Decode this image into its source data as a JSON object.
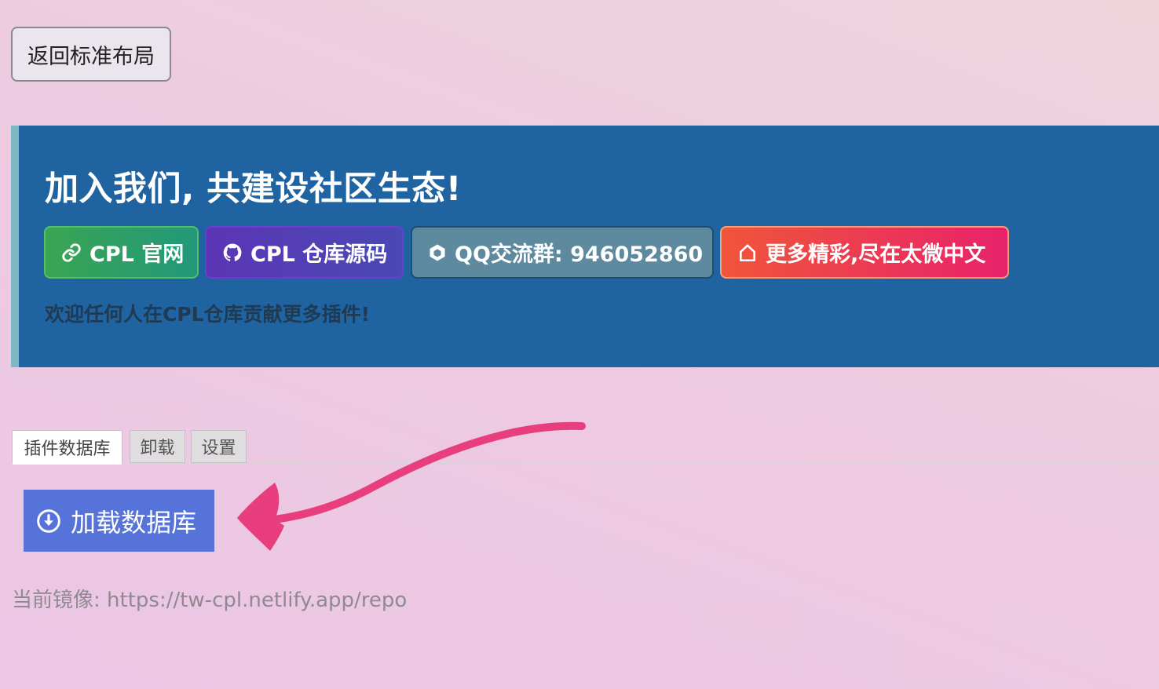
{
  "back_button": {
    "label": "返回标准布局"
  },
  "banner": {
    "title": "加入我们, 共建设社区生态!",
    "links": [
      {
        "icon": "link-icon",
        "label": "CPL 官网"
      },
      {
        "icon": "github-icon",
        "label": "CPL 仓库源码"
      },
      {
        "icon": "cube-icon",
        "label": "QQ交流群: 946052860"
      },
      {
        "icon": "home-icon",
        "label": "更多精彩,尽在太微中文"
      }
    ],
    "note": "欢迎任何人在CPL仓库贡献更多插件!"
  },
  "tabs": [
    {
      "label": "插件数据库",
      "active": true
    },
    {
      "label": "卸载",
      "active": false
    },
    {
      "label": "设置",
      "active": false
    }
  ],
  "load_button": {
    "icon": "download-circle-icon",
    "label": "加载数据库"
  },
  "mirror": {
    "label": "当前镜像:",
    "url": "https://tw-cpl.netlify.app/repo"
  },
  "annotation": {
    "icon": "pink-arrow-icon",
    "color": "#e83e7e"
  }
}
